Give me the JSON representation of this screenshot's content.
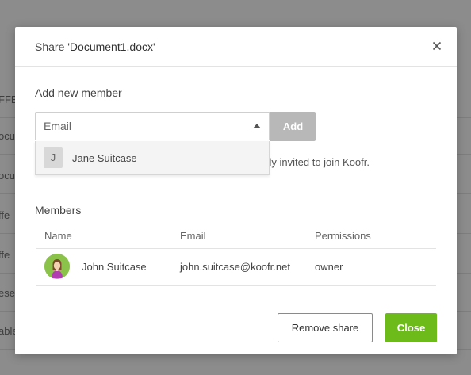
{
  "background_rows": [
    "FFE",
    "ocu",
    "ocu",
    "ffe",
    "ffe",
    "ese",
    "able"
  ],
  "dialog": {
    "title_prefix": "Share '",
    "document_name": "Document1.docx",
    "title_suffix": "'",
    "close_icon": "close-icon"
  },
  "add_member": {
    "heading": "Add new member",
    "email_placeholder": "Email",
    "email_value": "",
    "add_label": "Add",
    "info_text": "Users that are not yet registered will be automatically invited to join Koofr.",
    "suggestions": [
      {
        "initial": "J",
        "name": "Jane Suitcase"
      }
    ]
  },
  "members": {
    "heading": "Members",
    "columns": [
      "Name",
      "Email",
      "Permissions"
    ],
    "rows": [
      {
        "name": "John Suitcase",
        "email": "john.suitcase@koofr.net",
        "permission": "owner",
        "avatar_icon": "user-avatar-icon"
      }
    ]
  },
  "footer": {
    "remove_label": "Remove share",
    "close_label": "Close"
  },
  "colors": {
    "accent_green": "#6dbb1a",
    "disabled_button": "#b8b8b8",
    "overlay": "#8c8c8c"
  }
}
